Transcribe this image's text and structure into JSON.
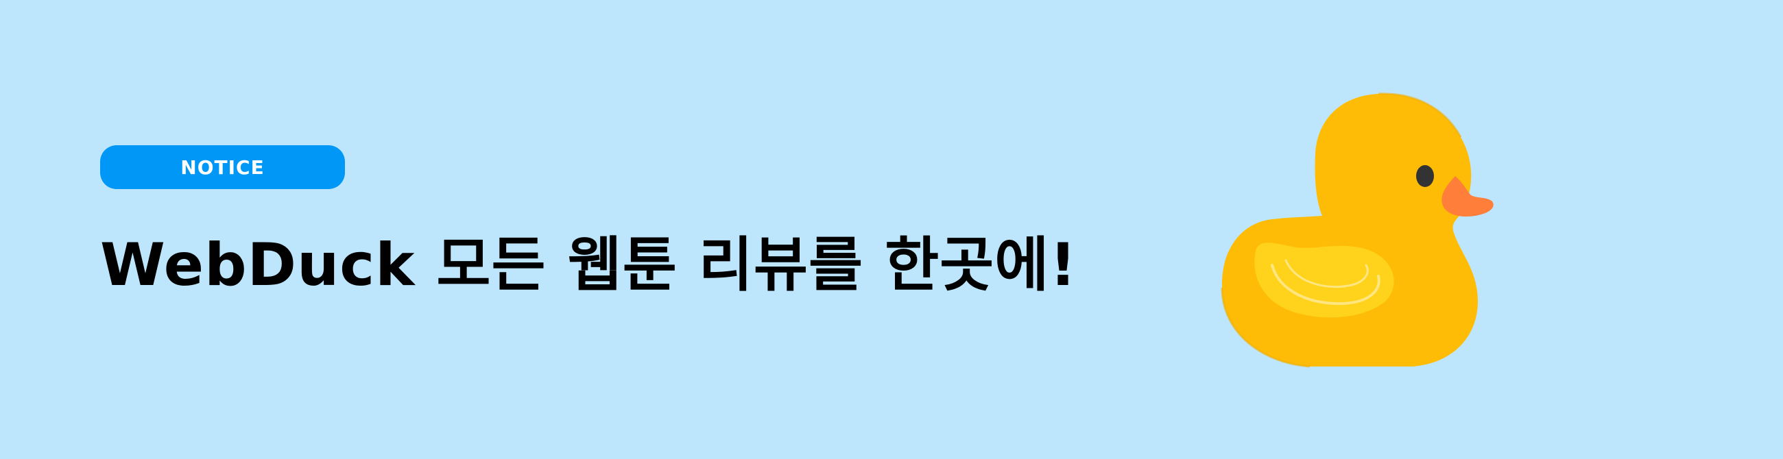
{
  "notice_badge": {
    "label": "NOTICE"
  },
  "headline": {
    "text": "WebDuck 모든 웹툰 리뷰를 한곳에!"
  },
  "illustration": {
    "icon": "rubber-duck-icon"
  },
  "colors": {
    "background": "#bde6fd",
    "badge": "#0197f6",
    "badge_text": "#ffffff",
    "headline_text": "#000000",
    "duck_body": "#ffbc06",
    "duck_wing": "#ffd21c",
    "duck_beak": "#fe7e3a",
    "duck_eye": "#333333"
  }
}
